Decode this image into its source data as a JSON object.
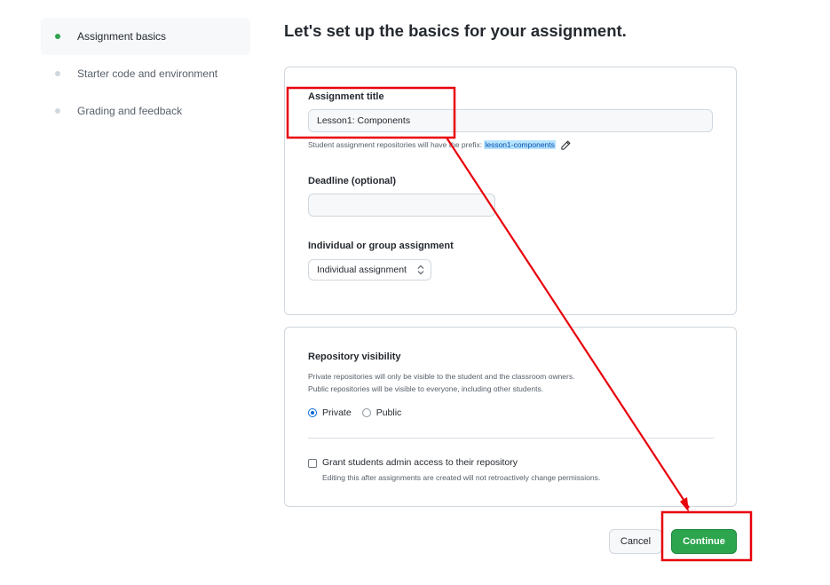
{
  "sidebar": {
    "steps": [
      {
        "label": "Assignment basics",
        "active": true
      },
      {
        "label": "Starter code and environment",
        "active": false
      },
      {
        "label": "Grading and feedback",
        "active": false
      }
    ]
  },
  "page_title": "Let's set up the basics for your assignment.",
  "assignment": {
    "title_label": "Assignment title",
    "title_value": "Lesson1: Components",
    "prefix_note": "Student assignment repositories will have the prefix:",
    "prefix_value": "lesson1-components",
    "deadline_label": "Deadline (optional)",
    "deadline_value": "",
    "type_label": "Individual or group assignment",
    "type_selected": "Individual assignment"
  },
  "visibility": {
    "label": "Repository visibility",
    "private_note": "Private repositories will only be visible to the student and the classroom owners.",
    "public_note": "Public repositories will be visible to everyone, including other students.",
    "private_label": "Private",
    "public_label": "Public",
    "selected": "Private",
    "admin_label": "Grant students admin access to their repository",
    "admin_note": "Editing this after assignments are created will not retroactively change permissions.",
    "admin_checked": false
  },
  "actions": {
    "cancel_label": "Cancel",
    "continue_label": "Continue"
  },
  "colors": {
    "accent_green": "#2da44e",
    "annotation_red": "#e8000b",
    "link_blue": "#0969da"
  },
  "icons": [
    "pencil-icon",
    "select-arrows-icon",
    "step-dot-icon"
  ]
}
